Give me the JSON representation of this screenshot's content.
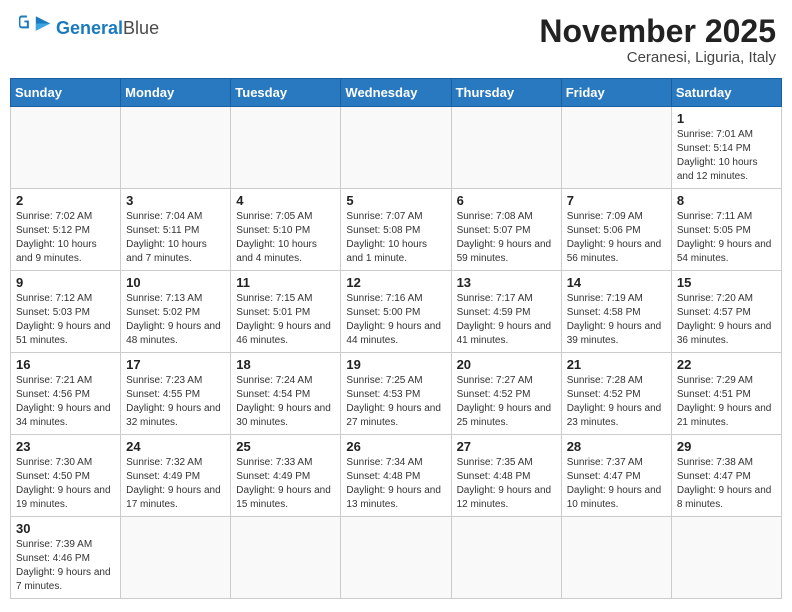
{
  "logo": {
    "general": "General",
    "blue": "Blue"
  },
  "title": "November 2025",
  "location": "Ceranesi, Liguria, Italy",
  "days_header": [
    "Sunday",
    "Monday",
    "Tuesday",
    "Wednesday",
    "Thursday",
    "Friday",
    "Saturday"
  ],
  "weeks": [
    [
      {
        "day": "",
        "info": ""
      },
      {
        "day": "",
        "info": ""
      },
      {
        "day": "",
        "info": ""
      },
      {
        "day": "",
        "info": ""
      },
      {
        "day": "",
        "info": ""
      },
      {
        "day": "",
        "info": ""
      },
      {
        "day": "1",
        "info": "Sunrise: 7:01 AM\nSunset: 5:14 PM\nDaylight: 10 hours\nand 12 minutes."
      }
    ],
    [
      {
        "day": "2",
        "info": "Sunrise: 7:02 AM\nSunset: 5:12 PM\nDaylight: 10 hours\nand 9 minutes."
      },
      {
        "day": "3",
        "info": "Sunrise: 7:04 AM\nSunset: 5:11 PM\nDaylight: 10 hours\nand 7 minutes."
      },
      {
        "day": "4",
        "info": "Sunrise: 7:05 AM\nSunset: 5:10 PM\nDaylight: 10 hours\nand 4 minutes."
      },
      {
        "day": "5",
        "info": "Sunrise: 7:07 AM\nSunset: 5:08 PM\nDaylight: 10 hours\nand 1 minute."
      },
      {
        "day": "6",
        "info": "Sunrise: 7:08 AM\nSunset: 5:07 PM\nDaylight: 9 hours\nand 59 minutes."
      },
      {
        "day": "7",
        "info": "Sunrise: 7:09 AM\nSunset: 5:06 PM\nDaylight: 9 hours\nand 56 minutes."
      },
      {
        "day": "8",
        "info": "Sunrise: 7:11 AM\nSunset: 5:05 PM\nDaylight: 9 hours\nand 54 minutes."
      }
    ],
    [
      {
        "day": "9",
        "info": "Sunrise: 7:12 AM\nSunset: 5:03 PM\nDaylight: 9 hours\nand 51 minutes."
      },
      {
        "day": "10",
        "info": "Sunrise: 7:13 AM\nSunset: 5:02 PM\nDaylight: 9 hours\nand 48 minutes."
      },
      {
        "day": "11",
        "info": "Sunrise: 7:15 AM\nSunset: 5:01 PM\nDaylight: 9 hours\nand 46 minutes."
      },
      {
        "day": "12",
        "info": "Sunrise: 7:16 AM\nSunset: 5:00 PM\nDaylight: 9 hours\nand 44 minutes."
      },
      {
        "day": "13",
        "info": "Sunrise: 7:17 AM\nSunset: 4:59 PM\nDaylight: 9 hours\nand 41 minutes."
      },
      {
        "day": "14",
        "info": "Sunrise: 7:19 AM\nSunset: 4:58 PM\nDaylight: 9 hours\nand 39 minutes."
      },
      {
        "day": "15",
        "info": "Sunrise: 7:20 AM\nSunset: 4:57 PM\nDaylight: 9 hours\nand 36 minutes."
      }
    ],
    [
      {
        "day": "16",
        "info": "Sunrise: 7:21 AM\nSunset: 4:56 PM\nDaylight: 9 hours\nand 34 minutes."
      },
      {
        "day": "17",
        "info": "Sunrise: 7:23 AM\nSunset: 4:55 PM\nDaylight: 9 hours\nand 32 minutes."
      },
      {
        "day": "18",
        "info": "Sunrise: 7:24 AM\nSunset: 4:54 PM\nDaylight: 9 hours\nand 30 minutes."
      },
      {
        "day": "19",
        "info": "Sunrise: 7:25 AM\nSunset: 4:53 PM\nDaylight: 9 hours\nand 27 minutes."
      },
      {
        "day": "20",
        "info": "Sunrise: 7:27 AM\nSunset: 4:52 PM\nDaylight: 9 hours\nand 25 minutes."
      },
      {
        "day": "21",
        "info": "Sunrise: 7:28 AM\nSunset: 4:52 PM\nDaylight: 9 hours\nand 23 minutes."
      },
      {
        "day": "22",
        "info": "Sunrise: 7:29 AM\nSunset: 4:51 PM\nDaylight: 9 hours\nand 21 minutes."
      }
    ],
    [
      {
        "day": "23",
        "info": "Sunrise: 7:30 AM\nSunset: 4:50 PM\nDaylight: 9 hours\nand 19 minutes."
      },
      {
        "day": "24",
        "info": "Sunrise: 7:32 AM\nSunset: 4:49 PM\nDaylight: 9 hours\nand 17 minutes."
      },
      {
        "day": "25",
        "info": "Sunrise: 7:33 AM\nSunset: 4:49 PM\nDaylight: 9 hours\nand 15 minutes."
      },
      {
        "day": "26",
        "info": "Sunrise: 7:34 AM\nSunset: 4:48 PM\nDaylight: 9 hours\nand 13 minutes."
      },
      {
        "day": "27",
        "info": "Sunrise: 7:35 AM\nSunset: 4:48 PM\nDaylight: 9 hours\nand 12 minutes."
      },
      {
        "day": "28",
        "info": "Sunrise: 7:37 AM\nSunset: 4:47 PM\nDaylight: 9 hours\nand 10 minutes."
      },
      {
        "day": "29",
        "info": "Sunrise: 7:38 AM\nSunset: 4:47 PM\nDaylight: 9 hours\nand 8 minutes."
      }
    ],
    [
      {
        "day": "30",
        "info": "Sunrise: 7:39 AM\nSunset: 4:46 PM\nDaylight: 9 hours\nand 7 minutes."
      },
      {
        "day": "",
        "info": ""
      },
      {
        "day": "",
        "info": ""
      },
      {
        "day": "",
        "info": ""
      },
      {
        "day": "",
        "info": ""
      },
      {
        "day": "",
        "info": ""
      },
      {
        "day": "",
        "info": ""
      }
    ]
  ]
}
